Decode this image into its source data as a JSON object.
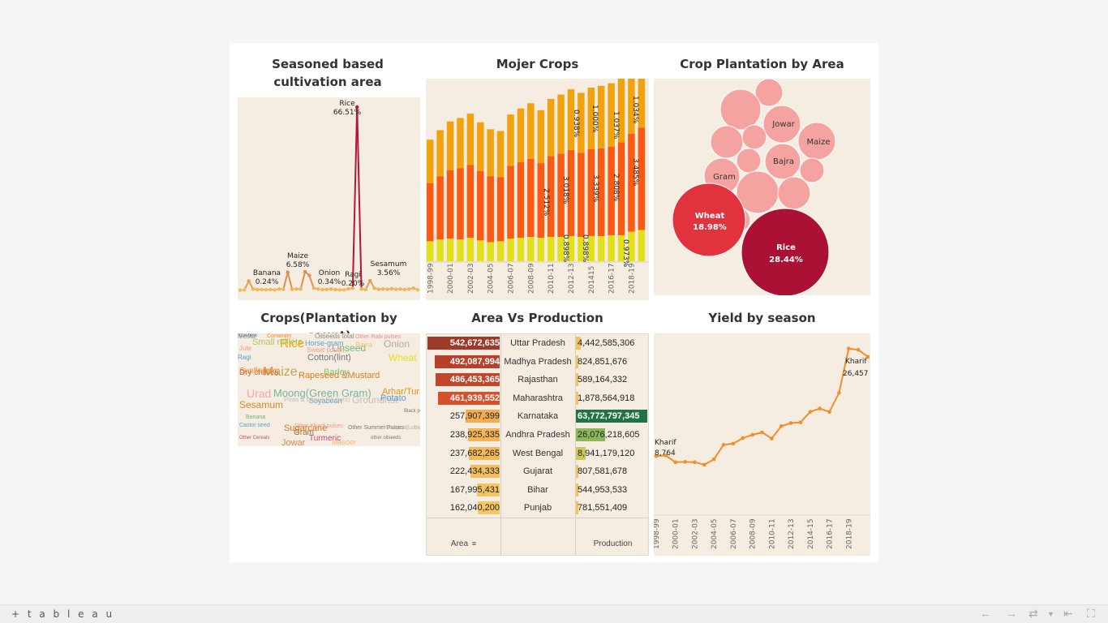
{
  "titles": {
    "season": "Seasoned based cultivation area",
    "mojer": "Mojer Crops",
    "plantation_area": "Crop Plantation by Area",
    "count": "Crops(Plantation by count)",
    "avp": "Area Vs Production",
    "yield": "Yield by season"
  },
  "season_chart": {
    "labels": [
      {
        "name": "Rice",
        "pct": "66.51%"
      },
      {
        "name": "Banana",
        "pct": "0.24%"
      },
      {
        "name": "Maize",
        "pct": "6.58%"
      },
      {
        "name": "Onion",
        "pct": "0.34%"
      },
      {
        "name": "Ragi",
        "pct": "0.20%"
      },
      {
        "name": "Sesamum",
        "pct": "3.56%"
      }
    ],
    "values": [
      0.1,
      0.2,
      3.4,
      0.5,
      0.3,
      0.3,
      0.24,
      0.3,
      0.2,
      0.5,
      0.4,
      6.58,
      0.4,
      0.5,
      0.5,
      6.8,
      5.4,
      0.8,
      0.5,
      0.3,
      0.34,
      0.5,
      0.3,
      0.2,
      0.2,
      0.6,
      0.8,
      66.51,
      0.5,
      0.3,
      3.56,
      0.8,
      0.4,
      0.5,
      0.4,
      0.6,
      0.4,
      0.5,
      0.3,
      0.5,
      0.8,
      0.2
    ],
    "color_low": "#f2c55c",
    "color_high": "#b5153a"
  },
  "chart_data": {
    "type": "bar",
    "categories": [
      "1998-99",
      "1999-00",
      "2000-01",
      "2001-02",
      "2002-03",
      "2003-04",
      "2004-05",
      "2005-06",
      "2006-07",
      "2007-08",
      "2008-09",
      "2009-10",
      "2010-11",
      "2011-12",
      "2012-13",
      "2013-14",
      "2014-15",
      "2015-16",
      "2016-17",
      "2017-18",
      "2018-19",
      "2019-20"
    ],
    "x_tick_labels": [
      "1998-99",
      "2000-01",
      "2002-03",
      "2004-05",
      "2006-07",
      "2008-09",
      "2010-11",
      "2012-13",
      "201415",
      "2016-17",
      "2018-19"
    ],
    "series": [
      {
        "values": [
          23,
          25,
          26,
          25,
          27,
          24,
          22,
          23,
          26,
          27,
          28,
          27,
          28,
          28,
          29,
          28,
          29,
          29,
          30,
          30,
          34,
          36
        ]
      },
      {
        "values": [
          67,
          73,
          79,
          82,
          84,
          80,
          76,
          74,
          84,
          87,
          90,
          86,
          93,
          96,
          99,
          97,
          100,
          101,
          102,
          107,
          113,
          118
        ]
      },
      {
        "values": [
          50,
          53,
          56,
          58,
          59,
          56,
          54,
          53,
          59,
          62,
          64,
          61,
          66,
          68,
          70,
          69,
          71,
          72,
          73,
          76,
          80,
          84
        ]
      }
    ],
    "colors": [
      "#e2df1b",
      "#fa5a13",
      "#f2a20c"
    ],
    "annotations": [
      "2.512%",
      "3.018%",
      "3.339%",
      "2.808%",
      "3.485%",
      "0.938%",
      "1.000%",
      "1.037%",
      "1.034%",
      "0.898%",
      "0.898%",
      "0.973%"
    ]
  },
  "bubbles": [
    {
      "name": "Wheat",
      "pct": "18.98%",
      "color": "#e0333e"
    },
    {
      "name": "Rice",
      "pct": "28.44%",
      "color": "#ab1135"
    },
    {
      "name": "Jowar",
      "pct": "",
      "color": "#f5a3a0"
    },
    {
      "name": "Maize",
      "pct": "",
      "color": "#f5a3a0"
    },
    {
      "name": "Bajra",
      "pct": "",
      "color": "#f5a3a0"
    },
    {
      "name": "Gram",
      "pct": "",
      "color": "#f5a3a0"
    }
  ],
  "wordcloud": [
    {
      "w": "Rice",
      "c": "#f2a20c"
    },
    {
      "w": "Maize",
      "c": "#c8a54e"
    },
    {
      "w": "Moong(Green Gram)",
      "c": "#72b5a0"
    },
    {
      "w": "Urad",
      "c": "#f7a5a5"
    },
    {
      "w": "Arhar/Tur",
      "c": "#e88f16"
    },
    {
      "w": "Groundnut",
      "c": "#c9bfb3"
    },
    {
      "w": "Sugarcane",
      "c": "#e06f12"
    },
    {
      "w": "Gram",
      "c": "#a8702b"
    },
    {
      "w": "Jowar",
      "c": "#d7894b"
    },
    {
      "w": "Turmeric",
      "c": "#c44a7a"
    },
    {
      "w": "Masoor",
      "c": "#f4b86f"
    },
    {
      "w": "Potato",
      "c": "#5b9ad3"
    },
    {
      "w": "Sesamum",
      "c": "#d08a24"
    },
    {
      "w": "Rapeseed &Mustard",
      "c": "#e07b1e"
    },
    {
      "w": "Dry chillies",
      "c": "#d9543d"
    },
    {
      "w": "Barley",
      "c": "#8bbf69"
    },
    {
      "w": "Sunflower",
      "c": "#f28e2b"
    },
    {
      "w": "Wheat",
      "c": "#e2df1b"
    },
    {
      "w": "Cotton(lint)",
      "c": "#777"
    },
    {
      "w": "Small millets",
      "c": "#a8c95f"
    },
    {
      "w": "Linseed",
      "c": "#6fb57a"
    },
    {
      "w": "Onion",
      "c": "#b3a8a8"
    },
    {
      "w": "Bajra",
      "c": "#f1c27d"
    },
    {
      "w": "Horse-gram",
      "c": "#5ea0c5"
    },
    {
      "w": "Sweet potato",
      "c": "#f59a8c"
    },
    {
      "w": "Other Rabi pulses",
      "c": "#e88f8f"
    },
    {
      "w": "Oilseeds total",
      "c": "#888"
    },
    {
      "w": "Coriander",
      "c": "#f28e2b"
    },
    {
      "w": "Jute",
      "c": "#f59a8c"
    },
    {
      "w": "Ragi",
      "c": "#5b9ad3"
    },
    {
      "w": "Soyabean",
      "c": "#5b9ad3"
    },
    {
      "w": "Peas & beans (Pulses)",
      "c": "#c9bfb3"
    },
    {
      "w": "Banana",
      "c": "#6fb57a"
    },
    {
      "w": "Castor seed",
      "c": "#5ea0c5"
    },
    {
      "w": "Other Kharif pulses",
      "c": "#f59a8c"
    },
    {
      "w": "Other Summer Pulses",
      "c": "#777"
    },
    {
      "w": "Cowpea(Lobia)",
      "c": "#b3a8a8"
    },
    {
      "w": "Other Cereals",
      "c": "#c44a7a"
    },
    {
      "w": "other oilseeds",
      "c": "#777"
    },
    {
      "w": "Black pepper",
      "c": "#777"
    },
    {
      "w": "Cashew",
      "c": "#2a7a8c"
    },
    {
      "w": "Mesta",
      "c": "#888"
    }
  ],
  "avp": {
    "rows": [
      {
        "area": "542,672,635",
        "a": 100,
        "state": "Uttar Pradesh",
        "prod": "4,442,585,306",
        "p": 7,
        "ac": "#9e3a2a",
        "pc": "#f2c55c"
      },
      {
        "area": "492,087,994",
        "a": 90,
        "state": "Madhya Pradesh",
        "prod": "824,851,676",
        "p": 1.3,
        "ac": "#b8402b",
        "pc": "#f2c55c"
      },
      {
        "area": "486,453,365",
        "a": 89,
        "state": "Rajasthan",
        "prod": "589,164,332",
        "p": 0.9,
        "ac": "#c0462c",
        "pc": "#f2c55c"
      },
      {
        "area": "461,939,552",
        "a": 85,
        "state": "Maharashtra",
        "prod": "1,878,564,918",
        "p": 3,
        "ac": "#d4512c",
        "pc": "#f2c55c"
      },
      {
        "area": "257,907,399",
        "a": 47,
        "state": "Karnataka",
        "prod": "63,772,797,345",
        "p": 100,
        "ac": "#f2ae4f",
        "pc": "#217346"
      },
      {
        "area": "238,925,335",
        "a": 44,
        "state": "Andhra Pradesh",
        "prod": "26,076,218,605",
        "p": 41,
        "ac": "#f3b455",
        "pc": "#8bb85a"
      },
      {
        "area": "237,682,265",
        "a": 43,
        "state": "West Bengal",
        "prod": "8,941,179,120",
        "p": 14,
        "ac": "#f3b85a",
        "pc": "#d0c75a"
      },
      {
        "area": "222,434,333",
        "a": 41,
        "state": "Gujarat",
        "prod": "807,581,678",
        "p": 1.3,
        "ac": "#f3bc5d",
        "pc": "#f2c55c"
      },
      {
        "area": "167,995,431",
        "a": 31,
        "state": "Bihar",
        "prod": "544,953,533",
        "p": 0.9,
        "ac": "#f4c462",
        "pc": "#f2c55c"
      },
      {
        "area": "162,040,200",
        "a": 30,
        "state": "Punjab",
        "prod": "781,551,409",
        "p": 1.2,
        "ac": "#f4c664",
        "pc": "#f2c55c"
      }
    ],
    "col_area": "Area",
    "col_prod": "Production"
  },
  "yield": {
    "values": [
      8764,
      8830,
      8120,
      8160,
      8130,
      7860,
      8430,
      9950,
      10070,
      10650,
      10990,
      11250,
      10600,
      11900,
      12230,
      12300,
      13400,
      13750,
      13400,
      15380,
      20030,
      19900,
      19170
    ],
    "start_label": {
      "season": "Kharif",
      "value": "8,764"
    },
    "end_label": {
      "season": "Kharif",
      "value": "26,457"
    },
    "x_tick_labels": [
      "1998-99",
      "2000-01",
      "2002-03",
      "2004-05",
      "2006-07",
      "2008-09",
      "2010-11",
      "2012-13",
      "2014-15",
      "2016-17",
      "2018-19"
    ],
    "color": "#f28e2b"
  },
  "footer": {
    "logo": "+ t a b l e a u"
  }
}
